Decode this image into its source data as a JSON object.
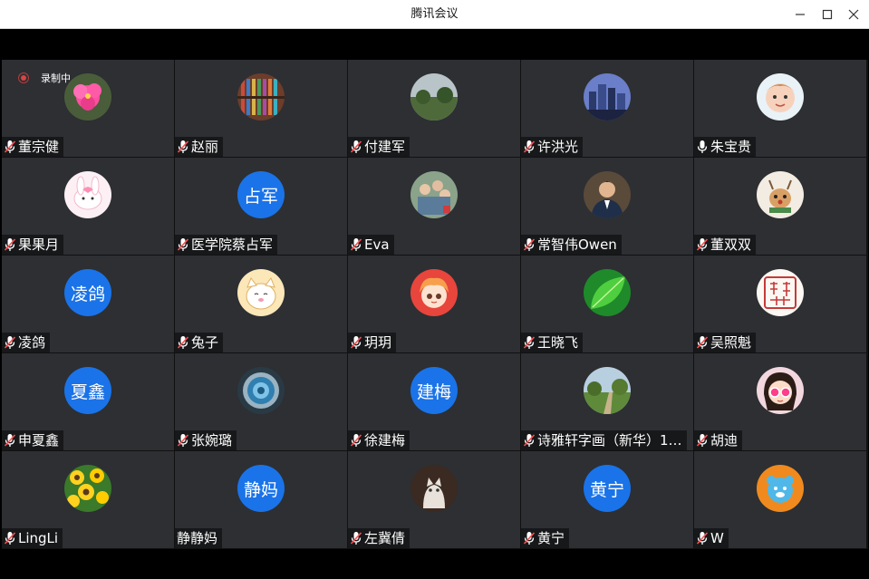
{
  "window": {
    "title": "腾讯会议",
    "minimize_icon": "minimize-icon",
    "maximize_icon": "maximize-icon",
    "close_icon": "close-icon"
  },
  "recording": {
    "label": "录制中"
  },
  "participants": [
    {
      "name": "董宗健",
      "muted": true,
      "avatar": {
        "type": "image",
        "icon": "flower-avatar"
      }
    },
    {
      "name": "赵丽",
      "muted": true,
      "avatar": {
        "type": "image",
        "icon": "bookshelf-avatar"
      }
    },
    {
      "name": "付建军",
      "muted": true,
      "avatar": {
        "type": "image",
        "icon": "landscape-avatar"
      }
    },
    {
      "name": "许洪光",
      "muted": true,
      "avatar": {
        "type": "image",
        "icon": "city-avatar"
      }
    },
    {
      "name": "朱宝贵",
      "muted": false,
      "avatar": {
        "type": "image",
        "icon": "baby-avatar"
      }
    },
    {
      "name": "果果月",
      "muted": true,
      "avatar": {
        "type": "image",
        "icon": "bunny-avatar"
      }
    },
    {
      "name": "医学院蔡占军",
      "muted": true,
      "avatar": {
        "type": "text",
        "text": "占军"
      }
    },
    {
      "name": "Eva",
      "muted": true,
      "avatar": {
        "type": "image",
        "icon": "group-photo-avatar"
      }
    },
    {
      "name": "常智伟Owen",
      "muted": true,
      "avatar": {
        "type": "image",
        "icon": "portrait-avatar"
      }
    },
    {
      "name": "董双双",
      "muted": true,
      "avatar": {
        "type": "image",
        "icon": "deer-cartoon-avatar"
      }
    },
    {
      "name": "凌鸽",
      "muted": true,
      "avatar": {
        "type": "text",
        "text": "凌鸽"
      }
    },
    {
      "name": "兔子",
      "muted": true,
      "avatar": {
        "type": "image",
        "icon": "lucky-cat-avatar"
      }
    },
    {
      "name": "玥玥",
      "muted": true,
      "avatar": {
        "type": "image",
        "icon": "anime-girl-avatar"
      }
    },
    {
      "name": "王晓飞",
      "muted": true,
      "avatar": {
        "type": "image",
        "icon": "green-leaf-avatar"
      }
    },
    {
      "name": "吴照魁",
      "muted": true,
      "avatar": {
        "type": "image",
        "icon": "seal-stamp-avatar"
      }
    },
    {
      "name": "申夏鑫",
      "muted": true,
      "avatar": {
        "type": "text",
        "text": "夏鑫"
      }
    },
    {
      "name": "张婉璐",
      "muted": true,
      "avatar": {
        "type": "image",
        "icon": "blue-button-avatar"
      }
    },
    {
      "name": "徐建梅",
      "muted": true,
      "avatar": {
        "type": "text",
        "text": "建梅"
      }
    },
    {
      "name": "诗雅轩字画（新华）1…",
      "muted": true,
      "avatar": {
        "type": "image",
        "icon": "park-avatar"
      }
    },
    {
      "name": "胡迪",
      "muted": true,
      "avatar": {
        "type": "image",
        "icon": "girl-glasses-avatar"
      }
    },
    {
      "name": "LingLi",
      "muted": true,
      "avatar": {
        "type": "image",
        "icon": "sunflower-avatar"
      }
    },
    {
      "name": "静静妈",
      "muted": null,
      "avatar": {
        "type": "text",
        "text": "静妈"
      }
    },
    {
      "name": "左冀倩",
      "muted": true,
      "avatar": {
        "type": "image",
        "icon": "cat-photo-avatar"
      }
    },
    {
      "name": "黄宁",
      "muted": true,
      "avatar": {
        "type": "text",
        "text": "黄宁"
      }
    },
    {
      "name": "W",
      "muted": true,
      "avatar": {
        "type": "image",
        "icon": "orange-bear-avatar"
      }
    }
  ],
  "colors": {
    "tile_bg": "#2d2f33",
    "label_bg": "#17181a",
    "text_avatar_bg": "#1a73e8",
    "muted_mic": "#ff4d4f",
    "recording": "#d64545"
  }
}
